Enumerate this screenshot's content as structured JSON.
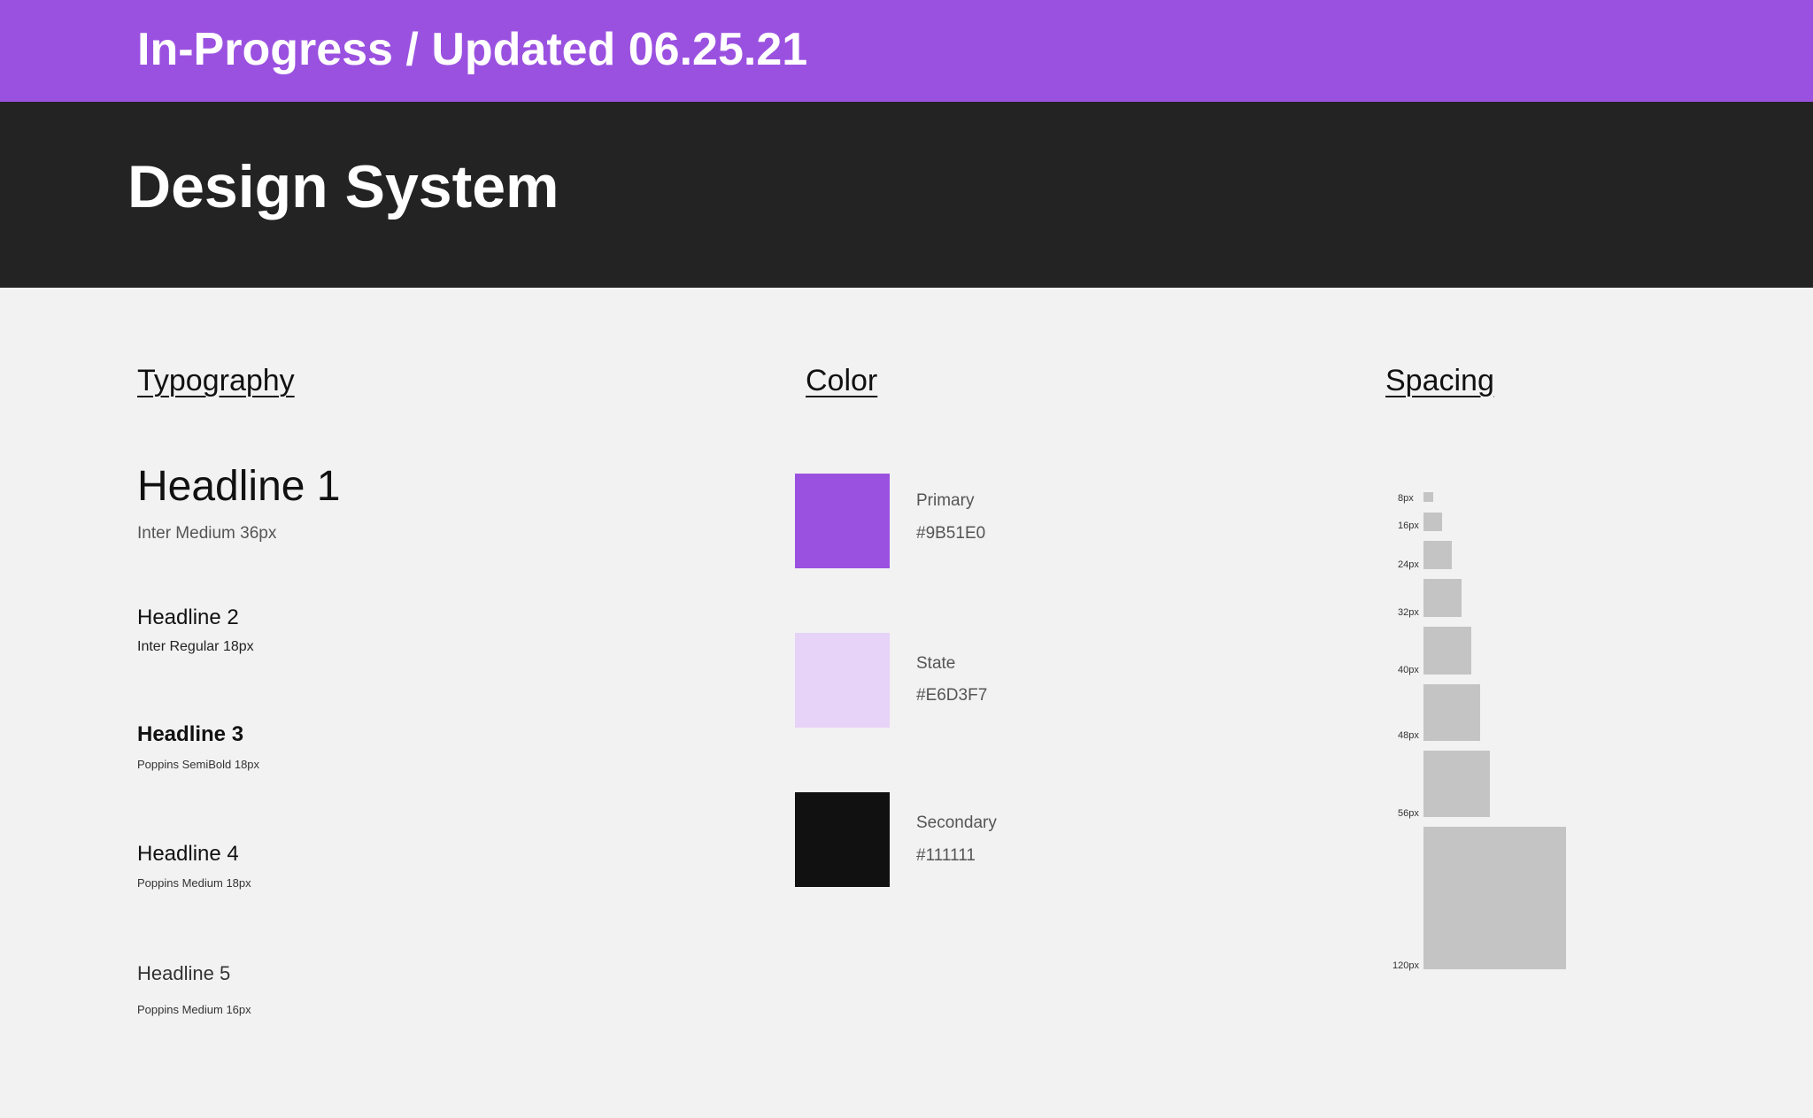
{
  "banner": {
    "text": "In-Progress / Updated 06.25.21",
    "color": "#9B51E0"
  },
  "hero": {
    "title": "Design System",
    "color": "#232323"
  },
  "sections": {
    "typography": "Typography",
    "color": "Color",
    "spacing": "Spacing"
  },
  "typography": [
    {
      "name": "Headline 1",
      "spec": "Inter Medium 36px"
    },
    {
      "name": "Headline 2",
      "spec": "Inter Regular 18px"
    },
    {
      "name": "Headline 3",
      "spec": "Poppins SemiBold 18px"
    },
    {
      "name": "Headline 4",
      "spec": "Poppins Medium 18px"
    },
    {
      "name": "Headline 5",
      "spec": "Poppins Medium 16px"
    }
  ],
  "colors": [
    {
      "label": "Primary",
      "hex": "#9B51E0"
    },
    {
      "label": "State",
      "hex": "#E6D3F7"
    },
    {
      "label": "Secondary",
      "hex": "#111111"
    }
  ],
  "spacing": [
    {
      "label": "8px"
    },
    {
      "label": "16px"
    },
    {
      "label": "24px"
    },
    {
      "label": "32px"
    },
    {
      "label": "40px"
    },
    {
      "label": "48px"
    },
    {
      "label": "56px"
    },
    {
      "label": "120px"
    }
  ]
}
